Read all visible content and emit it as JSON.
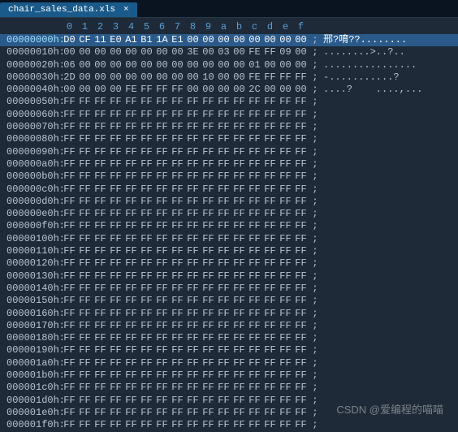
{
  "tab": {
    "filename": "chair_sales_data.xls",
    "close_glyph": "×"
  },
  "ruler": [
    "0",
    "1",
    "2",
    "3",
    "4",
    "5",
    "6",
    "7",
    "8",
    "9",
    "a",
    "b",
    "c",
    "d",
    "e",
    "f"
  ],
  "rows": [
    {
      "addr": "00000000h:",
      "hex": [
        "D0",
        "CF",
        "11",
        "E0",
        "A1",
        "B1",
        "1A",
        "E1",
        "00",
        "00",
        "00",
        "00",
        "00",
        "00",
        "00",
        "00"
      ],
      "ascii": "邢?唷??........",
      "sel": true
    },
    {
      "addr": "00000010h:",
      "hex": [
        "00",
        "00",
        "00",
        "00",
        "00",
        "00",
        "00",
        "00",
        "3E",
        "00",
        "03",
        "00",
        "FE",
        "FF",
        "09",
        "00"
      ],
      "ascii": "........>..?..",
      "sel": false
    },
    {
      "addr": "00000020h:",
      "hex": [
        "06",
        "00",
        "00",
        "00",
        "00",
        "00",
        "00",
        "00",
        "00",
        "00",
        "00",
        "00",
        "01",
        "00",
        "00",
        "00"
      ],
      "ascii": "................",
      "sel": false
    },
    {
      "addr": "00000030h:",
      "hex": [
        "2D",
        "00",
        "00",
        "00",
        "00",
        "00",
        "00",
        "00",
        "00",
        "10",
        "00",
        "00",
        "FE",
        "FF",
        "FF",
        "FF"
      ],
      "ascii": "-...........?",
      "sel": false
    },
    {
      "addr": "00000040h:",
      "hex": [
        "00",
        "00",
        "00",
        "00",
        "FE",
        "FF",
        "FF",
        "FF",
        "00",
        "00",
        "00",
        "00",
        "2C",
        "00",
        "00",
        "00"
      ],
      "ascii": "....?    ....,...",
      "sel": false
    },
    {
      "addr": "00000050h:",
      "hex": [
        "FF",
        "FF",
        "FF",
        "FF",
        "FF",
        "FF",
        "FF",
        "FF",
        "FF",
        "FF",
        "FF",
        "FF",
        "FF",
        "FF",
        "FF",
        "FF"
      ],
      "ascii": "",
      "sel": false
    },
    {
      "addr": "00000060h:",
      "hex": [
        "FF",
        "FF",
        "FF",
        "FF",
        "FF",
        "FF",
        "FF",
        "FF",
        "FF",
        "FF",
        "FF",
        "FF",
        "FF",
        "FF",
        "FF",
        "FF"
      ],
      "ascii": "",
      "sel": false
    },
    {
      "addr": "00000070h:",
      "hex": [
        "FF",
        "FF",
        "FF",
        "FF",
        "FF",
        "FF",
        "FF",
        "FF",
        "FF",
        "FF",
        "FF",
        "FF",
        "FF",
        "FF",
        "FF",
        "FF"
      ],
      "ascii": "",
      "sel": false
    },
    {
      "addr": "00000080h:",
      "hex": [
        "FF",
        "FF",
        "FF",
        "FF",
        "FF",
        "FF",
        "FF",
        "FF",
        "FF",
        "FF",
        "FF",
        "FF",
        "FF",
        "FF",
        "FF",
        "FF"
      ],
      "ascii": "",
      "sel": false
    },
    {
      "addr": "00000090h:",
      "hex": [
        "FF",
        "FF",
        "FF",
        "FF",
        "FF",
        "FF",
        "FF",
        "FF",
        "FF",
        "FF",
        "FF",
        "FF",
        "FF",
        "FF",
        "FF",
        "FF"
      ],
      "ascii": "",
      "sel": false
    },
    {
      "addr": "000000a0h:",
      "hex": [
        "FF",
        "FF",
        "FF",
        "FF",
        "FF",
        "FF",
        "FF",
        "FF",
        "FF",
        "FF",
        "FF",
        "FF",
        "FF",
        "FF",
        "FF",
        "FF"
      ],
      "ascii": "",
      "sel": false
    },
    {
      "addr": "000000b0h:",
      "hex": [
        "FF",
        "FF",
        "FF",
        "FF",
        "FF",
        "FF",
        "FF",
        "FF",
        "FF",
        "FF",
        "FF",
        "FF",
        "FF",
        "FF",
        "FF",
        "FF"
      ],
      "ascii": "",
      "sel": false
    },
    {
      "addr": "000000c0h:",
      "hex": [
        "FF",
        "FF",
        "FF",
        "FF",
        "FF",
        "FF",
        "FF",
        "FF",
        "FF",
        "FF",
        "FF",
        "FF",
        "FF",
        "FF",
        "FF",
        "FF"
      ],
      "ascii": "",
      "sel": false
    },
    {
      "addr": "000000d0h:",
      "hex": [
        "FF",
        "FF",
        "FF",
        "FF",
        "FF",
        "FF",
        "FF",
        "FF",
        "FF",
        "FF",
        "FF",
        "FF",
        "FF",
        "FF",
        "FF",
        "FF"
      ],
      "ascii": "",
      "sel": false
    },
    {
      "addr": "000000e0h:",
      "hex": [
        "FF",
        "FF",
        "FF",
        "FF",
        "FF",
        "FF",
        "FF",
        "FF",
        "FF",
        "FF",
        "FF",
        "FF",
        "FF",
        "FF",
        "FF",
        "FF"
      ],
      "ascii": "",
      "sel": false
    },
    {
      "addr": "000000f0h:",
      "hex": [
        "FF",
        "FF",
        "FF",
        "FF",
        "FF",
        "FF",
        "FF",
        "FF",
        "FF",
        "FF",
        "FF",
        "FF",
        "FF",
        "FF",
        "FF",
        "FF"
      ],
      "ascii": "",
      "sel": false
    },
    {
      "addr": "00000100h:",
      "hex": [
        "FF",
        "FF",
        "FF",
        "FF",
        "FF",
        "FF",
        "FF",
        "FF",
        "FF",
        "FF",
        "FF",
        "FF",
        "FF",
        "FF",
        "FF",
        "FF"
      ],
      "ascii": "",
      "sel": false
    },
    {
      "addr": "00000110h:",
      "hex": [
        "FF",
        "FF",
        "FF",
        "FF",
        "FF",
        "FF",
        "FF",
        "FF",
        "FF",
        "FF",
        "FF",
        "FF",
        "FF",
        "FF",
        "FF",
        "FF"
      ],
      "ascii": "",
      "sel": false
    },
    {
      "addr": "00000120h:",
      "hex": [
        "FF",
        "FF",
        "FF",
        "FF",
        "FF",
        "FF",
        "FF",
        "FF",
        "FF",
        "FF",
        "FF",
        "FF",
        "FF",
        "FF",
        "FF",
        "FF"
      ],
      "ascii": "",
      "sel": false
    },
    {
      "addr": "00000130h:",
      "hex": [
        "FF",
        "FF",
        "FF",
        "FF",
        "FF",
        "FF",
        "FF",
        "FF",
        "FF",
        "FF",
        "FF",
        "FF",
        "FF",
        "FF",
        "FF",
        "FF"
      ],
      "ascii": "",
      "sel": false
    },
    {
      "addr": "00000140h:",
      "hex": [
        "FF",
        "FF",
        "FF",
        "FF",
        "FF",
        "FF",
        "FF",
        "FF",
        "FF",
        "FF",
        "FF",
        "FF",
        "FF",
        "FF",
        "FF",
        "FF"
      ],
      "ascii": "",
      "sel": false
    },
    {
      "addr": "00000150h:",
      "hex": [
        "FF",
        "FF",
        "FF",
        "FF",
        "FF",
        "FF",
        "FF",
        "FF",
        "FF",
        "FF",
        "FF",
        "FF",
        "FF",
        "FF",
        "FF",
        "FF"
      ],
      "ascii": "",
      "sel": false
    },
    {
      "addr": "00000160h:",
      "hex": [
        "FF",
        "FF",
        "FF",
        "FF",
        "FF",
        "FF",
        "FF",
        "FF",
        "FF",
        "FF",
        "FF",
        "FF",
        "FF",
        "FF",
        "FF",
        "FF"
      ],
      "ascii": "",
      "sel": false
    },
    {
      "addr": "00000170h:",
      "hex": [
        "FF",
        "FF",
        "FF",
        "FF",
        "FF",
        "FF",
        "FF",
        "FF",
        "FF",
        "FF",
        "FF",
        "FF",
        "FF",
        "FF",
        "FF",
        "FF"
      ],
      "ascii": "",
      "sel": false
    },
    {
      "addr": "00000180h:",
      "hex": [
        "FF",
        "FF",
        "FF",
        "FF",
        "FF",
        "FF",
        "FF",
        "FF",
        "FF",
        "FF",
        "FF",
        "FF",
        "FF",
        "FF",
        "FF",
        "FF"
      ],
      "ascii": "",
      "sel": false
    },
    {
      "addr": "00000190h:",
      "hex": [
        "FF",
        "FF",
        "FF",
        "FF",
        "FF",
        "FF",
        "FF",
        "FF",
        "FF",
        "FF",
        "FF",
        "FF",
        "FF",
        "FF",
        "FF",
        "FF"
      ],
      "ascii": "",
      "sel": false
    },
    {
      "addr": "000001a0h:",
      "hex": [
        "FF",
        "FF",
        "FF",
        "FF",
        "FF",
        "FF",
        "FF",
        "FF",
        "FF",
        "FF",
        "FF",
        "FF",
        "FF",
        "FF",
        "FF",
        "FF"
      ],
      "ascii": "",
      "sel": false
    },
    {
      "addr": "000001b0h:",
      "hex": [
        "FF",
        "FF",
        "FF",
        "FF",
        "FF",
        "FF",
        "FF",
        "FF",
        "FF",
        "FF",
        "FF",
        "FF",
        "FF",
        "FF",
        "FF",
        "FF"
      ],
      "ascii": "",
      "sel": false
    },
    {
      "addr": "000001c0h:",
      "hex": [
        "FF",
        "FF",
        "FF",
        "FF",
        "FF",
        "FF",
        "FF",
        "FF",
        "FF",
        "FF",
        "FF",
        "FF",
        "FF",
        "FF",
        "FF",
        "FF"
      ],
      "ascii": "",
      "sel": false
    },
    {
      "addr": "000001d0h:",
      "hex": [
        "FF",
        "FF",
        "FF",
        "FF",
        "FF",
        "FF",
        "FF",
        "FF",
        "FF",
        "FF",
        "FF",
        "FF",
        "FF",
        "FF",
        "FF",
        "FF"
      ],
      "ascii": "",
      "sel": false
    },
    {
      "addr": "000001e0h:",
      "hex": [
        "FF",
        "FF",
        "FF",
        "FF",
        "FF",
        "FF",
        "FF",
        "FF",
        "FF",
        "FF",
        "FF",
        "FF",
        "FF",
        "FF",
        "FF",
        "FF"
      ],
      "ascii": "",
      "sel": false
    },
    {
      "addr": "000001f0h:",
      "hex": [
        "FF",
        "FF",
        "FF",
        "FF",
        "FF",
        "FF",
        "FF",
        "FF",
        "FF",
        "FF",
        "FF",
        "FF",
        "FF",
        "FF",
        "FF",
        "FF"
      ],
      "ascii": "",
      "sel": false
    }
  ],
  "separator": ";",
  "watermark": "CSDN @爱编程的喵喵"
}
